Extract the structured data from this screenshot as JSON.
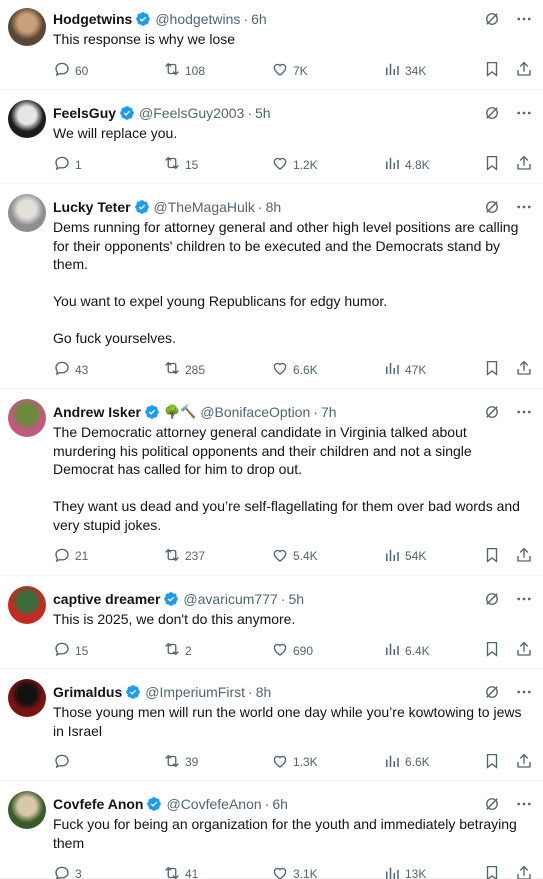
{
  "tweets": [
    {
      "name": "Hodgetwins",
      "handle": "@hodgetwins",
      "time": "6h",
      "text": "This response is why we lose",
      "replies": "60",
      "retweets": "108",
      "likes": "7K",
      "views": "34K",
      "avatar_colors": [
        "#5a4634",
        "#caa07c"
      ]
    },
    {
      "name": "FeelsGuy",
      "handle": "@FeelsGuy2003",
      "time": "5h",
      "text": "We will replace you.",
      "replies": "1",
      "retweets": "15",
      "likes": "1.2K",
      "views": "4.8K",
      "avatar_colors": [
        "#1c1c1c",
        "#e6e6e6"
      ]
    },
    {
      "name": "Lucky Teter",
      "handle": "@TheMagaHulk",
      "time": "8h",
      "text": "Dems running for attorney general and other high level positions are calling for their opponents' children to be executed and the Democrats stand by them.\n\nYou want to expel young Republicans for edgy humor.\n\nGo fuck yourselves.",
      "replies": "43",
      "retweets": "285",
      "likes": "6.6K",
      "views": "47K",
      "avatar_colors": [
        "#8a8f93",
        "#e4e0d8"
      ]
    },
    {
      "name": "Andrew Isker",
      "emoji": "🌳🔨",
      "handle": "@BonifaceOption",
      "time": "7h",
      "text": "The Democratic attorney general candidate in Virginia talked about murdering his political opponents and their children and not a single Democrat has called for him to drop out.\n\nThey want us dead and you’re self-flagellating for them over bad words and very stupid jokes.",
      "replies": "21",
      "retweets": "237",
      "likes": "5.4K",
      "views": "54K",
      "avatar_colors": [
        "#c05a7e",
        "#6a8a3c"
      ]
    },
    {
      "name": "captive dreamer",
      "handle": "@avaricum777",
      "time": "5h",
      "text": "This is 2025, we don't do this anymore.",
      "replies": "15",
      "retweets": "2",
      "likes": "690",
      "views": "6.4K",
      "avatar_colors": [
        "#c8281e",
        "#3a6b3a"
      ]
    },
    {
      "name": "Grimaldus",
      "handle": "@ImperiumFirst",
      "time": "8h",
      "text": "Those young men will run the world one day while you’re kowtowing to jews in Israel",
      "replies": "",
      "retweets": "39",
      "likes": "1.3K",
      "views": "6.6K",
      "avatar_colors": [
        "#7a1414",
        "#111111"
      ]
    },
    {
      "name": "Covfefe Anon",
      "handle": "@CovfefeAnon",
      "time": "6h",
      "text": "Fuck you for being an organization for the youth and immediately betraying them",
      "replies": "3",
      "retweets": "41",
      "likes": "3.1K",
      "views": "13K",
      "avatar_colors": [
        "#3a5a2a",
        "#d8c8a8"
      ]
    }
  ],
  "colors": {
    "verified": "#1d9bf0",
    "secondary": "#536471",
    "divider": "#eff3f4"
  }
}
